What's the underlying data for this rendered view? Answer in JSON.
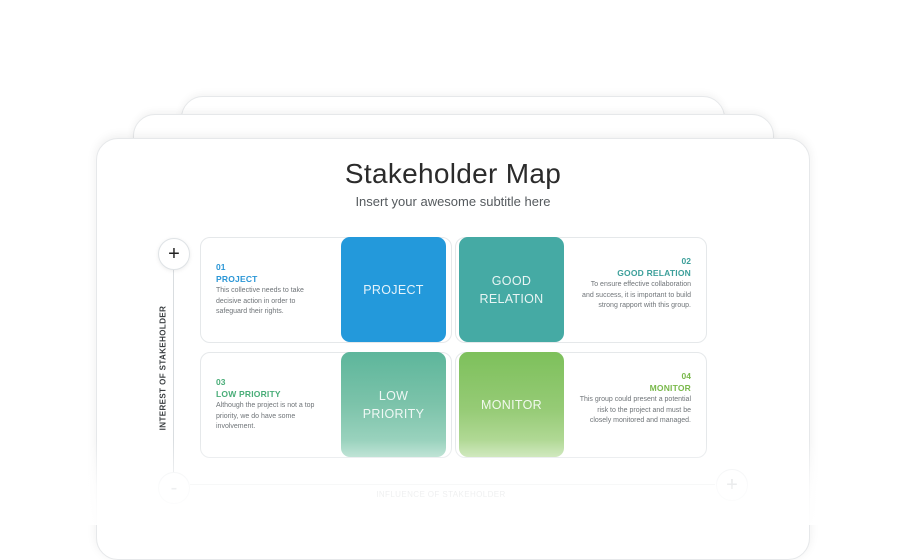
{
  "title": "Stakeholder Map",
  "subtitle": "Insert your awesome subtitle here",
  "axes": {
    "y_label": "INTEREST OF STAKEHOLDER",
    "x_label": "INFLUENCE OF STAKEHOLDER",
    "y_top_symbol": "+",
    "origin_symbol": "-",
    "x_right_symbol": "+"
  },
  "quadrants": [
    {
      "tile_label": "PROJECT",
      "number": "01",
      "heading": "PROJECT",
      "description": "This collective needs to take decisive action in order to safeguard their rights.",
      "color": "#2399db"
    },
    {
      "tile_label": "GOOD\nRELATION",
      "number": "02",
      "heading": "GOOD RELATION",
      "description": "To ensure effective collaboration and success, it is important to build strong rapport with this group.",
      "color": "#45aaa4"
    },
    {
      "tile_label": "LOW\nPRIORITY",
      "number": "03",
      "heading": "LOW PRIORITY",
      "description": "Although the project is not a top priority, we do have some involvement.",
      "color": "#5db69b"
    },
    {
      "tile_label": "MONITOR",
      "number": "04",
      "heading": "MONITOR",
      "description": "This group could present a potential risk to the project and must be closely monitored and managed.",
      "color": "#7dc05b"
    }
  ]
}
